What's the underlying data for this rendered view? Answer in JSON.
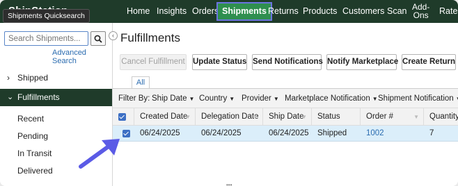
{
  "app": {
    "brand": "ShipStation",
    "tooltip": "Shipments Quicksearch"
  },
  "nav": {
    "home": "Home",
    "insights": "Insights",
    "orders": "Orders",
    "shipments": "Shipments",
    "returns": "Returns",
    "products": "Products",
    "customers": "Customers",
    "scan": "Scan",
    "addons_line1": "Add-",
    "addons_line2": "Ons",
    "rates": "Rates"
  },
  "sidebar": {
    "search_placeholder": "Search Shipments...",
    "search_icon": "search-icon",
    "advanced_search": "Advanced Search",
    "shipped": "Shipped",
    "fulfillments": "Fulfillments",
    "sub_items": [
      "Recent",
      "Pending",
      "In Transit",
      "Delivered"
    ]
  },
  "main": {
    "title": "Fulfillments",
    "buttons": {
      "cancel": "Cancel Fulfillment",
      "update_status": "Update Status",
      "send_notifications": "Send Notifications",
      "notify_marketplace": "Notify Marketplace",
      "create_return": "Create Return"
    },
    "tab_all": "All",
    "filter": {
      "label": "Filter By:",
      "items": [
        "Ship Date",
        "Country",
        "Provider",
        "Marketplace Notification",
        "Shipment Notification"
      ]
    },
    "table": {
      "headers": [
        "Created Date",
        "Delegation Date",
        "Ship Date",
        "Status",
        "Order #",
        "Quantity"
      ],
      "rows": [
        {
          "created": "06/24/2025",
          "delegation": "06/24/2025",
          "ship": "06/24/2025",
          "status": "Shipped",
          "order": "1002",
          "quantity": "7"
        }
      ]
    }
  },
  "colors": {
    "nav_bg": "#1f3b2a",
    "active_tab_bg": "#2f8f4f",
    "active_outline": "#6b74e0",
    "link": "#2b6cb0",
    "selected_row": "#dbeefa",
    "arrow": "#5b5be6"
  }
}
